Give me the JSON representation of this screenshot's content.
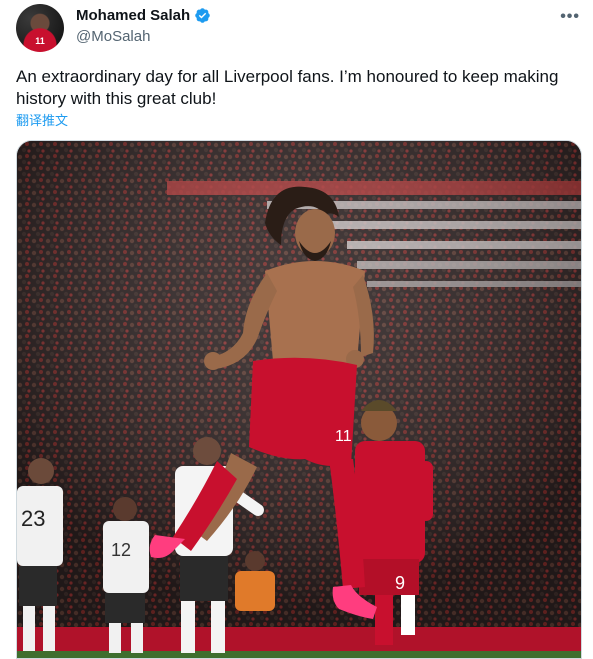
{
  "author": {
    "display_name": "Mohamed Salah",
    "handle": "@MoSalah",
    "avatar_jersey_number": "11",
    "verified_color": "#1d9bf0"
  },
  "menu": {
    "more_label": "•••"
  },
  "tweet": {
    "text": "An extraordinary day for all Liverpool fans. I’m honoured to keep making history with this great club!",
    "translate_label": "翻译推文"
  },
  "photo": {
    "player_number": "11",
    "teammate_number": "9",
    "opponent_numbers": [
      "23",
      "12"
    ],
    "accent_color": "#c8102e"
  }
}
